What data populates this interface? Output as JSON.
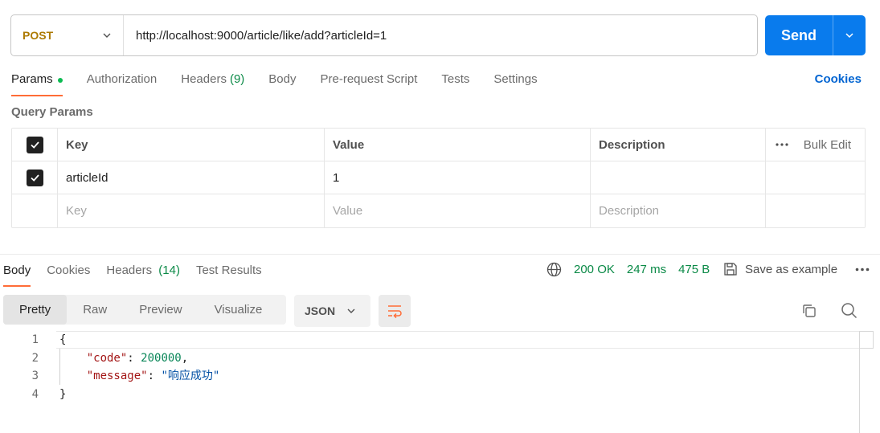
{
  "request": {
    "method": "POST",
    "url": "http://localhost:9000/article/like/add?articleId=1",
    "send_label": "Send"
  },
  "request_tabs": [
    {
      "label": "Params",
      "active": true,
      "dot": true
    },
    {
      "label": "Authorization"
    },
    {
      "label": "Headers",
      "count": "(9)"
    },
    {
      "label": "Body"
    },
    {
      "label": "Pre-request Script"
    },
    {
      "label": "Tests"
    },
    {
      "label": "Settings"
    }
  ],
  "cookies_link": "Cookies",
  "query_params": {
    "title": "Query Params",
    "headers": {
      "key": "Key",
      "value": "Value",
      "description": "Description",
      "bulk_edit": "Bulk Edit"
    },
    "rows": [
      {
        "checked": true,
        "key": "articleId",
        "value": "1",
        "description": ""
      }
    ],
    "placeholders": {
      "key": "Key",
      "value": "Value",
      "description": "Description"
    }
  },
  "response_tabs": [
    {
      "label": "Body",
      "active": true
    },
    {
      "label": "Cookies"
    },
    {
      "label": "Headers",
      "count": "(14)"
    },
    {
      "label": "Test Results"
    }
  ],
  "response_status": {
    "status": "200 OK",
    "time": "247 ms",
    "size": "475 B",
    "save_example": "Save as example"
  },
  "view_modes": [
    "Pretty",
    "Raw",
    "Preview",
    "Visualize"
  ],
  "selected_view": "Pretty",
  "format": "JSON",
  "response_body": {
    "line_numbers": [
      "1",
      "2",
      "3",
      "4"
    ],
    "open_brace": "{",
    "close_brace": "}",
    "fields": [
      {
        "key": "\"code\"",
        "value": "200000",
        "trailing": ","
      },
      {
        "key": "\"message\"",
        "value": "\"响应成功\"",
        "trailing": ""
      }
    ]
  },
  "colors": {
    "send": "#097bed",
    "method": "#ad7a03",
    "active_tab_underline": "#ff6c37",
    "status_green": "#0b8a47",
    "link_blue": "#0265d2"
  }
}
